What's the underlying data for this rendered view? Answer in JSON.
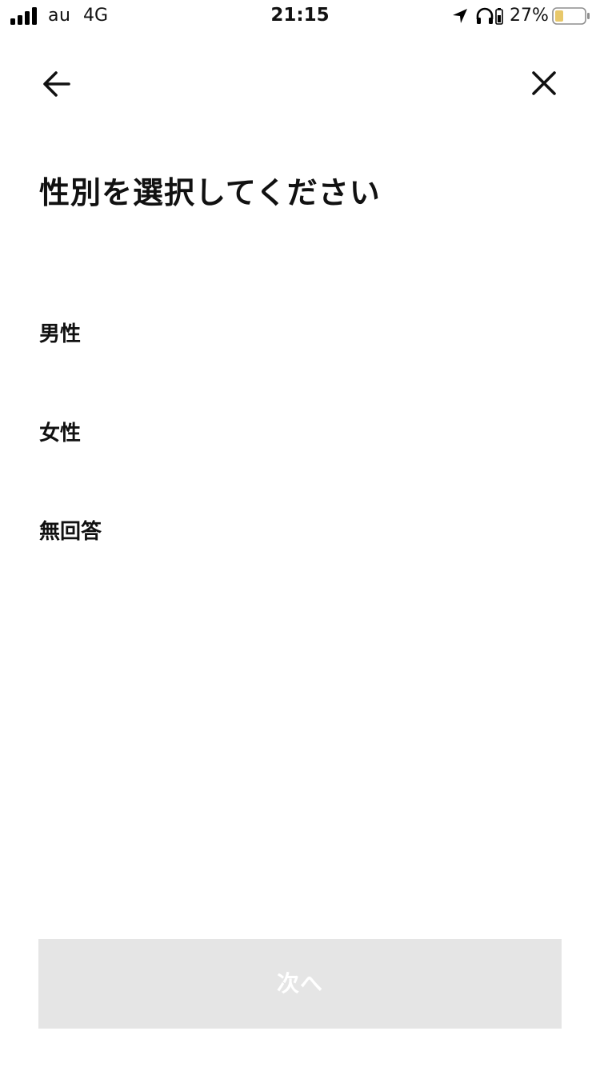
{
  "status_bar": {
    "carrier": "au",
    "network": "4G",
    "time": "21:15",
    "battery_percent": "27%",
    "battery_color": "#e8c86a",
    "icons": [
      "signal-icon",
      "location-icon",
      "headphones-icon",
      "charging-icon",
      "battery-icon"
    ]
  },
  "nav": {
    "back_icon": "arrow-left-icon",
    "close_icon": "close-icon"
  },
  "page": {
    "title": "性別を選択してください"
  },
  "options": [
    {
      "label": "男性"
    },
    {
      "label": "女性"
    },
    {
      "label": "無回答"
    }
  ],
  "footer": {
    "next_label": "次へ",
    "next_enabled": false,
    "next_bg_color": "#e5e5e5"
  }
}
